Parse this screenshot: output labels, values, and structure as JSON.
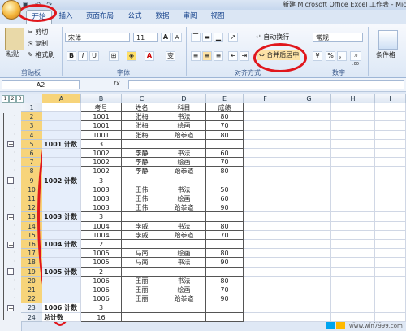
{
  "window": {
    "title": "新建 Microsoft Office Excel 工作表 - Mic"
  },
  "tabs": [
    "开始",
    "插入",
    "页面布局",
    "公式",
    "数据",
    "审阅",
    "视图"
  ],
  "ribbon": {
    "clipboard": {
      "paste": "粘贴",
      "cut": "剪切",
      "copy": "复制",
      "format_painter": "格式刷",
      "label": "剪贴板"
    },
    "font": {
      "name": "宋体",
      "size": "11",
      "label": "字体",
      "bold": "B",
      "italic": "I",
      "underline": "U",
      "grow": "A",
      "shrink": "A",
      "color_a": "A",
      "wen": "变"
    },
    "alignment": {
      "wrap": "自动换行",
      "merge": "合并后居中",
      "label": "对齐方式"
    },
    "number": {
      "format": "常规",
      "label": "数字",
      "percent": "%",
      "comma": "，",
      "inc_dec": ".0 .00",
      "dec_dec": ".00 .0"
    },
    "styles": {
      "conditional": "条件格"
    }
  },
  "formula_bar": {
    "cell_ref": "A2",
    "fx": "fx",
    "value": ""
  },
  "outline_levels": [
    "1",
    "2",
    "3"
  ],
  "columns": [
    "A",
    "B",
    "C",
    "D",
    "E",
    "F",
    "G",
    "H",
    "I"
  ],
  "rows": [
    {
      "n": "1",
      "a": "",
      "b": "考号",
      "c": "姓名",
      "d": "科目",
      "e": "成绩",
      "outline": ""
    },
    {
      "n": "2",
      "a": "",
      "b": "1001",
      "c": "张梅",
      "d": "书法",
      "e": "80",
      "outline": "dot"
    },
    {
      "n": "3",
      "a": "",
      "b": "1001",
      "c": "张梅",
      "d": "绘画",
      "e": "70",
      "outline": "dot"
    },
    {
      "n": "4",
      "a": "",
      "b": "1001",
      "c": "张梅",
      "d": "跆拳道",
      "e": "80",
      "outline": "dot"
    },
    {
      "n": "5",
      "a": "1001 计数",
      "b": "3",
      "c": "",
      "d": "",
      "e": "",
      "outline": "minus"
    },
    {
      "n": "6",
      "a": "",
      "b": "1002",
      "c": "李静",
      "d": "书法",
      "e": "60",
      "outline": "dot"
    },
    {
      "n": "7",
      "a": "",
      "b": "1002",
      "c": "李静",
      "d": "绘画",
      "e": "70",
      "outline": "dot"
    },
    {
      "n": "8",
      "a": "",
      "b": "1002",
      "c": "李静",
      "d": "跆拳道",
      "e": "80",
      "outline": "dot"
    },
    {
      "n": "9",
      "a": "1002 计数",
      "b": "3",
      "c": "",
      "d": "",
      "e": "",
      "outline": "minus"
    },
    {
      "n": "10",
      "a": "",
      "b": "1003",
      "c": "王伟",
      "d": "书法",
      "e": "50",
      "outline": "dot"
    },
    {
      "n": "11",
      "a": "",
      "b": "1003",
      "c": "王伟",
      "d": "绘画",
      "e": "60",
      "outline": "dot"
    },
    {
      "n": "12",
      "a": "",
      "b": "1003",
      "c": "王伟",
      "d": "跆拳道",
      "e": "90",
      "outline": "dot"
    },
    {
      "n": "13",
      "a": "1003 计数",
      "b": "3",
      "c": "",
      "d": "",
      "e": "",
      "outline": "minus"
    },
    {
      "n": "14",
      "a": "",
      "b": "1004",
      "c": "李威",
      "d": "书法",
      "e": "80",
      "outline": "dot"
    },
    {
      "n": "15",
      "a": "",
      "b": "1004",
      "c": "李威",
      "d": "跆拳道",
      "e": "70",
      "outline": "dot"
    },
    {
      "n": "16",
      "a": "1004 计数",
      "b": "2",
      "c": "",
      "d": "",
      "e": "",
      "outline": "minus"
    },
    {
      "n": "17",
      "a": "",
      "b": "1005",
      "c": "马南",
      "d": "绘画",
      "e": "80",
      "outline": "dot"
    },
    {
      "n": "18",
      "a": "",
      "b": "1005",
      "c": "马南",
      "d": "书法",
      "e": "90",
      "outline": "dot"
    },
    {
      "n": "19",
      "a": "1005 计数",
      "b": "2",
      "c": "",
      "d": "",
      "e": "",
      "outline": "minus"
    },
    {
      "n": "20",
      "a": "",
      "b": "1006",
      "c": "王丽",
      "d": "书法",
      "e": "80",
      "outline": "dot"
    },
    {
      "n": "21",
      "a": "",
      "b": "1006",
      "c": "王丽",
      "d": "绘画",
      "e": "70",
      "outline": "dot"
    },
    {
      "n": "22",
      "a": "",
      "b": "1006",
      "c": "王丽",
      "d": "跆拳道",
      "e": "90",
      "outline": "dot"
    },
    {
      "n": "23",
      "a": "1006 计数",
      "b": "3",
      "c": "",
      "d": "",
      "e": "",
      "outline": "minus"
    },
    {
      "n": "24",
      "a": "总计数",
      "b": "16",
      "c": "",
      "d": "",
      "e": "",
      "outline": ""
    }
  ],
  "watermark": {
    "text": "系统粉",
    "url": "www.win7999.com"
  },
  "colors": {
    "annotation_red": "#e0161c",
    "selection": "#f7d47a"
  }
}
